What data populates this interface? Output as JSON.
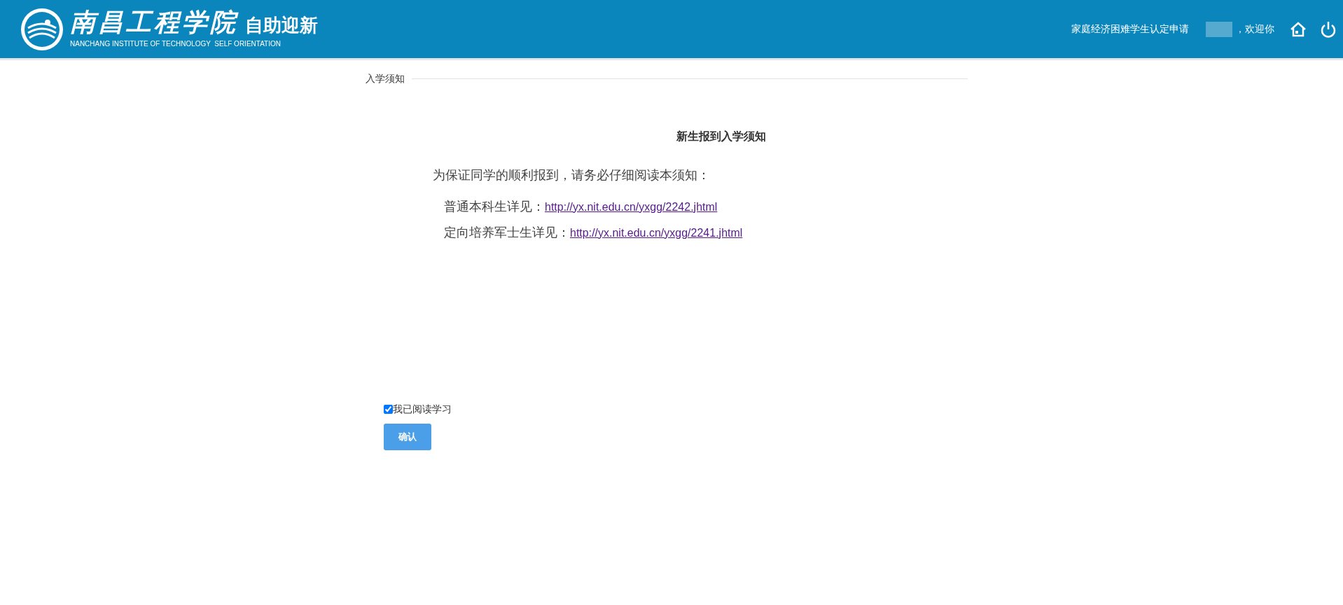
{
  "header": {
    "logo_title": "南昌工程学院",
    "logo_subtitle": "自助迎新",
    "logo_english": "NANCHANG INSTITUTE OF TECHNOLOGY  SELF ORIENTATION",
    "nav_link": "家庭经济困难学生认定申请",
    "welcome": "，欢迎你"
  },
  "section": {
    "legend": "入学须知"
  },
  "notice": {
    "title": "新生报到入学须知",
    "intro": "为保证同学的顺利报到，请务必仔细阅读本须知：",
    "links": [
      {
        "label": "普通本科生详见：",
        "url": "http://yx.nit.edu.cn/yxgg/2242.jhtml"
      },
      {
        "label": "定向培养军士生详见：",
        "url": "http://yx.nit.edu.cn/yxgg/2241.jhtml"
      }
    ]
  },
  "agreement": {
    "label": "我已阅读学习",
    "checked": true
  },
  "confirm_button": "确认"
}
